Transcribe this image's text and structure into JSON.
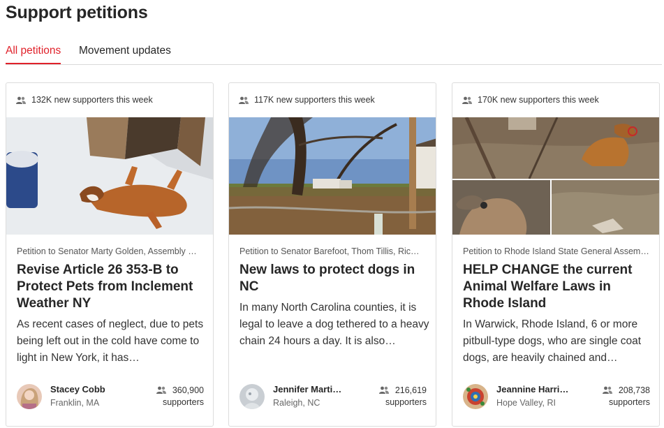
{
  "page": {
    "title": "Support petitions"
  },
  "tabs": [
    {
      "label": "All petitions",
      "active": true
    },
    {
      "label": "Movement updates",
      "active": false
    }
  ],
  "colors": {
    "accent": "#e0212a",
    "border": "#dcdcdc",
    "text": "#262626"
  },
  "icons": {
    "supporters": "people-icon"
  },
  "cards": [
    {
      "weekly": "132K new supporters this week",
      "target": "Petition to Senator Marty Golden, Assembly …",
      "headline": "Revise Article 26 353-B to Protect Pets from Inclement Weather NY",
      "description": "As recent cases of neglect, due to pets being left out in the cold have come to light in New York, it has…",
      "author": "Stacey Cobb",
      "location": "Franklin, MA",
      "supporters_count": "360,900",
      "supporters_label": "supporters"
    },
    {
      "weekly": "117K new supporters this week",
      "target": "Petition to Senator Barefoot, Thom Tillis, Ric…",
      "headline": "New laws to protect dogs in NC",
      "description": "In many North Carolina counties, it is legal to leave a dog tethered to a heavy chain 24 hours a day. It is also…",
      "author": "Jennifer Marti…",
      "location": "Raleigh, NC",
      "supporters_count": "216,619",
      "supporters_label": "supporters"
    },
    {
      "weekly": "170K new supporters this week",
      "target": "Petition to Rhode Island State General Assem…",
      "headline": "HELP CHANGE the current Animal Welfare Laws in Rhode Island",
      "description": "In Warwick, Rhode Island, 6 or more pitbull-type dogs, who are single coat dogs, are heavily chained and…",
      "author": "Jeannine Harri…",
      "location": "Hope Valley, RI",
      "supporters_count": "208,738",
      "supporters_label": "supporters"
    }
  ]
}
